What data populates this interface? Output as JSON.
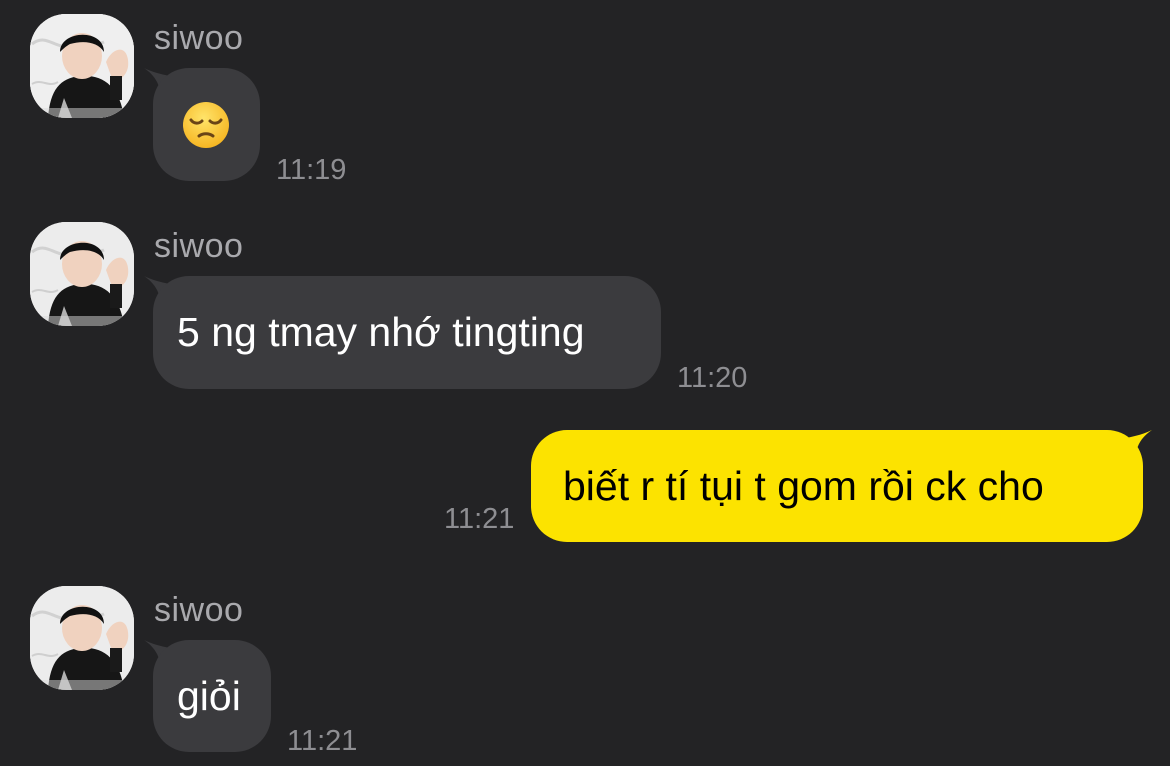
{
  "messages": [
    {
      "direction": "in",
      "sender": "siwoo",
      "content_kind": "emoji",
      "emoji": "pensive-face",
      "text": "😔",
      "time": "11:19"
    },
    {
      "direction": "in",
      "sender": "siwoo",
      "content_kind": "text",
      "text": "5 ng tmay nhớ tingting",
      "time": "11:20"
    },
    {
      "direction": "out",
      "content_kind": "text",
      "text": "biết r tí tụi t gom rồi ck cho",
      "time": "11:21"
    },
    {
      "direction": "in",
      "sender": "siwoo",
      "content_kind": "text",
      "text": "giỏi",
      "time": "11:21"
    }
  ],
  "colors": {
    "background": "#232325",
    "incoming_bubble": "#3b3b3e",
    "outgoing_bubble": "#fce300",
    "timestamp": "#8e8e92",
    "sender_name": "#a9a9ad"
  },
  "icons": {
    "avatar": "profile-photo",
    "emoji": "pensive-face-icon"
  }
}
